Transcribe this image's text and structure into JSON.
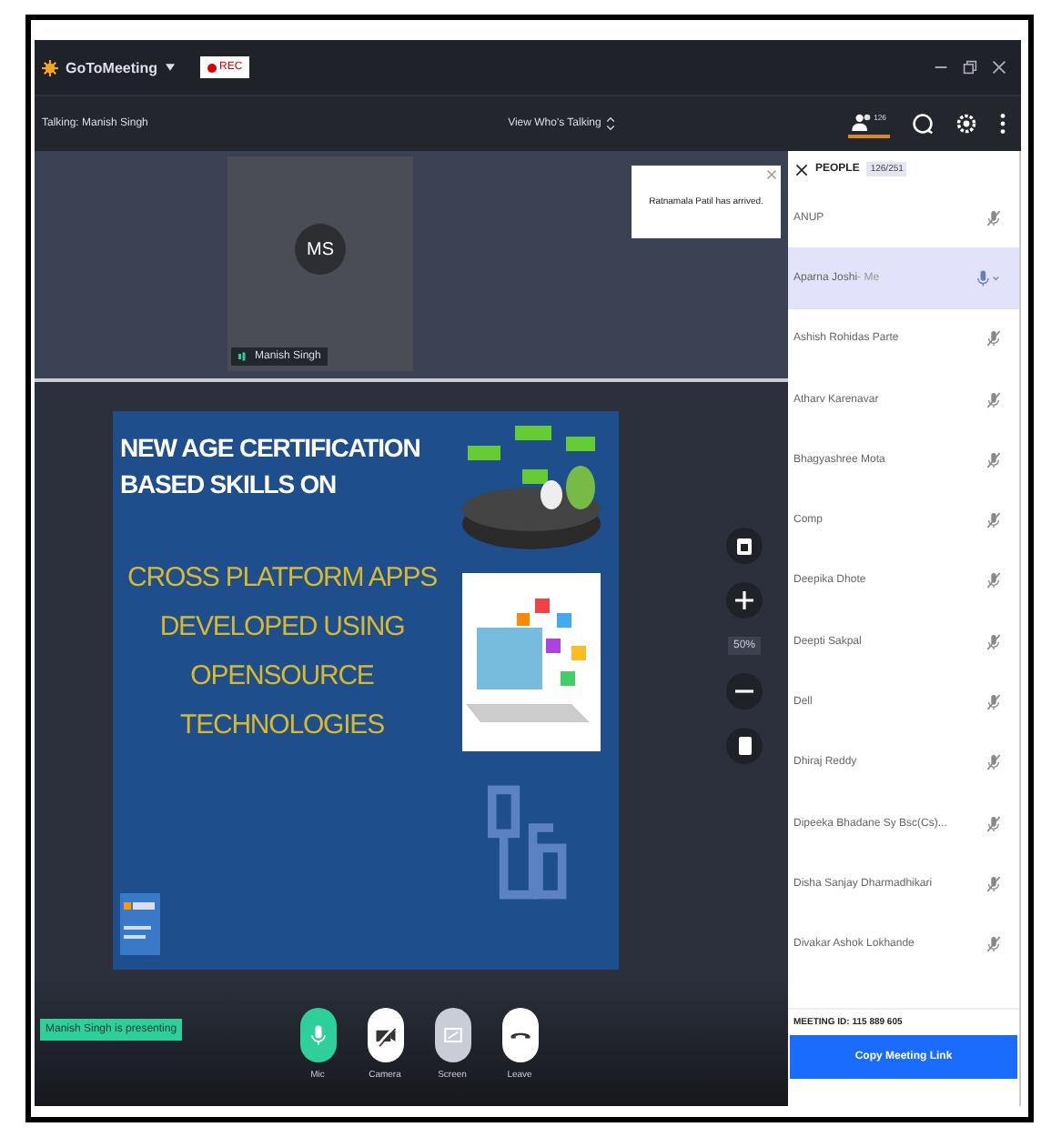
{
  "titlebar": {
    "logo": "GoToMeeting",
    "rec": "REC"
  },
  "subbar": {
    "talking": "Talking: Manish Singh",
    "view_toggle": "View Who's Talking",
    "people_count": "126"
  },
  "video_tile": {
    "initials": "MS",
    "name": "Manish Singh"
  },
  "toast": {
    "message": "Ratnamala Patil has arrived."
  },
  "slide": {
    "heading_lines": [
      "NEW AGE CERTIFICATION",
      "BASED SKILLS ON"
    ],
    "body_lines": [
      "CROSS PLATFORM APPS",
      "DEVELOPED USING",
      "OPENSOURCE",
      "TECHNOLOGIES"
    ]
  },
  "zoom_controls": {
    "level_text": "50%"
  },
  "presenter_badge": "Manish Singh is presenting",
  "controls": [
    {
      "kind": "mic",
      "label": "Mic",
      "on": true,
      "disabled": false
    },
    {
      "kind": "camera",
      "label": "Camera",
      "on": false,
      "disabled": false
    },
    {
      "kind": "screen",
      "label": "Screen",
      "on": false,
      "disabled": true
    },
    {
      "kind": "leave",
      "label": "Leave",
      "on": false,
      "disabled": false
    }
  ],
  "people_panel": {
    "title": "PEOPLE",
    "count": "126/251",
    "people": [
      {
        "name": "ANUP",
        "selected": false,
        "muted": true
      },
      {
        "name": "Aparna Joshi",
        "tag": "- Me",
        "selected": true,
        "muted": false
      },
      {
        "name": "Ashish Rohidas Parte",
        "selected": false,
        "muted": true
      },
      {
        "name": "Atharv Karenavar",
        "selected": false,
        "muted": true
      },
      {
        "name": "Bhagyashree Mota",
        "selected": false,
        "muted": true
      },
      {
        "name": "Comp",
        "selected": false,
        "muted": true
      },
      {
        "name": "Deepika Dhote",
        "selected": false,
        "muted": true
      },
      {
        "name": "Deepti Sakpal",
        "selected": false,
        "muted": true
      },
      {
        "name": "Dell",
        "selected": false,
        "muted": true
      },
      {
        "name": "Dhiraj Reddy",
        "selected": false,
        "muted": true
      },
      {
        "name": "Dipeeka Bhadane Sy Bsc(Cs)...",
        "selected": false,
        "muted": true
      },
      {
        "name": "Disha Sanjay Dharmadhikari",
        "selected": false,
        "muted": true
      },
      {
        "name": "Divakar Ashok Lokhande",
        "selected": false,
        "muted": true
      }
    ],
    "meeting_id_label": "MEETING ID:",
    "meeting_id": "115 889 605",
    "copy_button": "Copy Meeting Link"
  }
}
